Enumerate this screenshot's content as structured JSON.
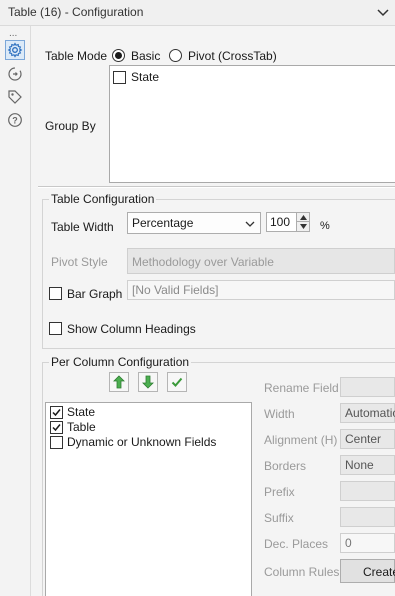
{
  "window": {
    "title": "Table (16) - Configuration"
  },
  "sidebar": {
    "dots": "...",
    "icons": [
      "gear-icon",
      "connection-icon",
      "tag-icon",
      "help-icon"
    ]
  },
  "table_mode": {
    "label": "Table Mode",
    "options": [
      "Basic",
      "Pivot (CrossTab)"
    ],
    "selected": "Basic"
  },
  "group_by": {
    "label": "Group By",
    "items": [
      {
        "label": "State",
        "checked": false
      }
    ]
  },
  "table_config": {
    "section_title": "Table Configuration",
    "width_label": "Table Width",
    "width_mode": "Percentage",
    "width_value": "100",
    "width_unit": "%",
    "pivot_style_label": "Pivot Style",
    "pivot_style_value": "Methodology over Variable",
    "bar_graph_label": "Bar Graph",
    "bar_graph_checked": false,
    "bar_graph_value": "[No Valid Fields]",
    "show_column_headings_label": "Show Column Headings",
    "show_column_headings_checked": false
  },
  "per_column": {
    "section_title": "Per Column Configuration",
    "fields": [
      {
        "label": "State",
        "checked": true
      },
      {
        "label": "Table",
        "checked": true
      },
      {
        "label": "Dynamic or Unknown Fields",
        "checked": false
      }
    ],
    "props": {
      "rename_field_label": "Rename Field",
      "rename_field_value": "",
      "width_label": "Width",
      "width_value": "Automatic",
      "alignment_label": "Alignment (H)",
      "alignment_value": "Center",
      "borders_label": "Borders",
      "borders_value": "None",
      "prefix_label": "Prefix",
      "prefix_value": "",
      "suffix_label": "Suffix",
      "suffix_value": "",
      "dec_places_label": "Dec. Places",
      "dec_places_value": "0",
      "column_rules_label": "Column Rules",
      "column_rules_button": "Create"
    }
  },
  "colors": {
    "accent_green": "#3a9a3a",
    "active_tab_border": "#7ca7d8",
    "disabled_text": "#9a9a9a"
  }
}
